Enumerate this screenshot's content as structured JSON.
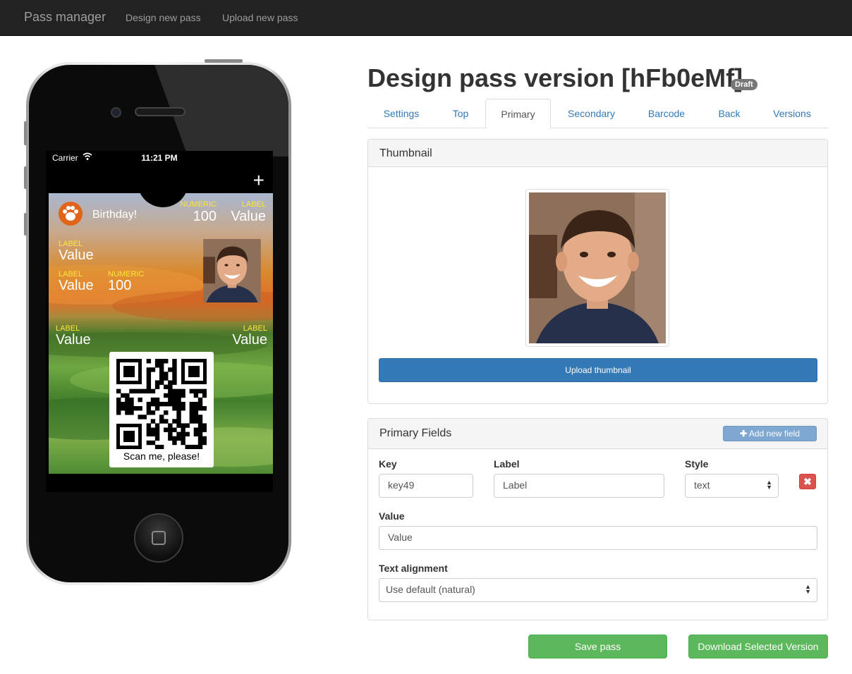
{
  "navbar": {
    "brand": "Pass manager",
    "links": [
      "Design new pass",
      "Upload new pass"
    ]
  },
  "phone": {
    "status": {
      "carrier": "Carrier",
      "time": "11:21 PM"
    },
    "plus_icon": "+",
    "pass": {
      "logo_text": "Birthday!",
      "header_fields": [
        {
          "label": "NUMERIC",
          "value": "100"
        },
        {
          "label": "LABEL",
          "value": "Value"
        }
      ],
      "primary_field": {
        "label": "LABEL",
        "value": "Value"
      },
      "secondary_fields": [
        {
          "label": "LABEL",
          "value": "Value"
        },
        {
          "label": "NUMERIC",
          "value": "100"
        }
      ],
      "auxiliary_fields": [
        {
          "label": "LABEL",
          "value": "Value"
        },
        {
          "label": "LABEL",
          "value": "Value"
        }
      ],
      "barcode_caption": "Scan me, please!"
    }
  },
  "page": {
    "title": "Design pass version [hFb0eMf]",
    "badge": "Draft"
  },
  "tabs": [
    {
      "label": "Settings",
      "active": false
    },
    {
      "label": "Top",
      "active": false
    },
    {
      "label": "Primary",
      "active": true
    },
    {
      "label": "Secondary",
      "active": false
    },
    {
      "label": "Barcode",
      "active": false
    },
    {
      "label": "Back",
      "active": false
    },
    {
      "label": "Versions",
      "active": false
    }
  ],
  "thumbnail_panel": {
    "title": "Thumbnail",
    "upload_button": "Upload thumbnail"
  },
  "primary_fields_panel": {
    "title": "Primary Fields",
    "add_button": "Add new field",
    "field": {
      "key_label": "Key",
      "key_value": "key49",
      "label_label": "Label",
      "label_value": "Label",
      "style_label": "Style",
      "style_value": "text",
      "value_label": "Value",
      "value_value": "Value",
      "alignment_label": "Text alignment",
      "alignment_value": "Use default (natural)"
    },
    "remove_icon": "✖"
  },
  "footer_buttons": {
    "save": "Save pass",
    "download": "Download Selected Version"
  },
  "colors": {
    "navbar_bg": "#222222",
    "link": "#337ab7",
    "primary_button": "#337ab7",
    "success_button": "#5cb85c",
    "danger_button": "#d9534f",
    "pass_label": "#ffe53b"
  }
}
